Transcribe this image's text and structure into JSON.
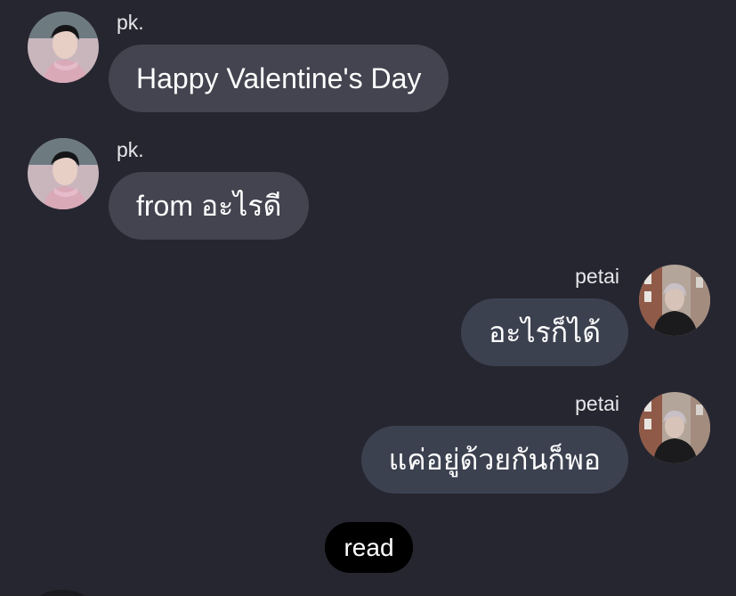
{
  "messages": [
    {
      "sender": "pk.",
      "text": "Happy Valentine's Day",
      "direction": "incoming",
      "avatar": "avatar-pk"
    },
    {
      "sender": "pk.",
      "text": "from อะไรดี",
      "direction": "incoming",
      "avatar": "avatar-pk"
    },
    {
      "sender": "petai",
      "text": "อะไรก็ได้",
      "direction": "outgoing",
      "avatar": "avatar-petai"
    },
    {
      "sender": "petai",
      "text": "แค่อยู่ด้วยกันก็พอ",
      "direction": "outgoing",
      "avatar": "avatar-petai"
    }
  ],
  "read_receipt": "read",
  "colors": {
    "background": "#262630",
    "incoming_bubble": "#43444f",
    "outgoing_bubble": "#3c4150",
    "read_pill": "#000000",
    "text": "#ffffff"
  }
}
